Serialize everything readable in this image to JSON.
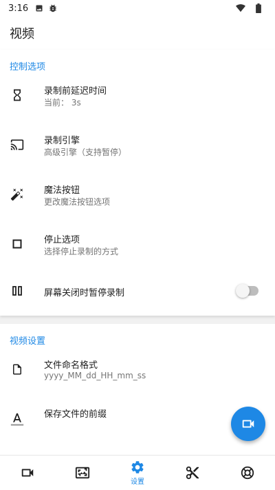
{
  "status_bar": {
    "time": "3:16",
    "left_icons": [
      "image-icon",
      "bug-icon"
    ],
    "right_icons": [
      "wifi-icon",
      "battery-icon"
    ]
  },
  "app_bar": {
    "title": "视频"
  },
  "control_section": {
    "header": "控制选项",
    "items": [
      {
        "icon": "hourglass-icon",
        "title": "录制前延迟时间",
        "subtitle": "当前： 3s"
      },
      {
        "icon": "cast-icon",
        "title": "录制引擎",
        "subtitle": "高级引擎（支持暂停）"
      },
      {
        "icon": "magic-wand-icon",
        "title": "魔法按钮",
        "subtitle": "更改魔法按钮选项"
      },
      {
        "icon": "stop-icon",
        "title": "停止选项",
        "subtitle": "选择停止录制的方式"
      },
      {
        "icon": "pause-icon",
        "title": "屏幕关闭时暂停录制",
        "toggle_on": false
      }
    ]
  },
  "video_section": {
    "header": "视频设置",
    "items": [
      {
        "icon": "file-icon",
        "title": "文件命名格式",
        "subtitle": "yyyy_MM_dd_HH_mm_ss"
      },
      {
        "icon": "text-format-icon",
        "title": "保存文件的前缀"
      }
    ]
  },
  "fab": {
    "icon": "videocam-icon"
  },
  "bottom_nav": {
    "items": [
      {
        "icon": "videocam-icon",
        "label": ""
      },
      {
        "icon": "screenshot-icon",
        "label": ""
      },
      {
        "icon": "settings-icon",
        "label": "设置",
        "active": true
      },
      {
        "icon": "scissors-icon",
        "label": ""
      },
      {
        "icon": "help-lifebuoy-icon",
        "label": ""
      }
    ]
  },
  "colors": {
    "accent": "#1e88e5",
    "background": "#f1f1f1",
    "surface": "#ffffff",
    "text_primary": "#202020",
    "text_secondary": "#757575"
  }
}
